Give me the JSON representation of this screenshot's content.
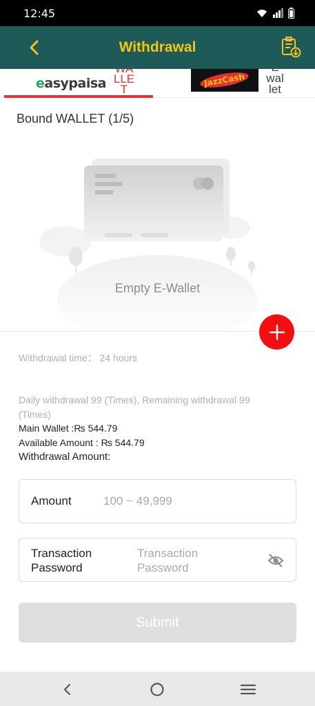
{
  "status": {
    "time": "12:45"
  },
  "header": {
    "title": "Withdrawal"
  },
  "tabs": [
    {
      "logo": "easypaisa",
      "sub": "WA LLE T"
    },
    {
      "logo": "JazzCash",
      "sub": "E wal let"
    }
  ],
  "wallet": {
    "bound_title": "Bound WALLET (1/5)",
    "empty_text": "Empty E-Wallet"
  },
  "info": {
    "withdrawal_time": "Withdrawal time：  24 hours",
    "daily_line1": "Daily withdrawal 99 (Times), Remaining withdrawal 99",
    "daily_line2": "(Times)",
    "main_wallet": "Main Wallet :₨ 544.79",
    "available": "Available Amount : ₨ 544.79",
    "withdrawal_amount": "Withdrawal Amount:"
  },
  "form": {
    "amount_label": "Amount",
    "amount_placeholder": "100 ~ 49,999",
    "password_label_1": "Transaction",
    "password_label_2": "Password",
    "password_placeholder_1": "Transaction",
    "password_placeholder_2": "Password",
    "submit": "Submit"
  },
  "icons": {
    "back": "chevron-left-icon",
    "record": "clipboard-download-icon",
    "eye": "eye-off-icon",
    "add": "plus-icon"
  },
  "colors": {
    "header": "#1e5a58",
    "accent": "#f5c518",
    "red": "#f20f12",
    "underline": "#e0322f"
  }
}
